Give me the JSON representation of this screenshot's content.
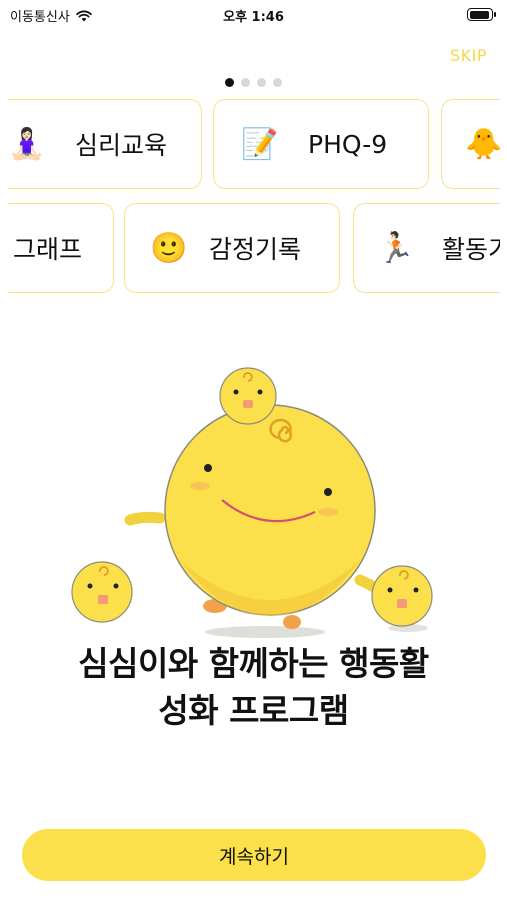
{
  "status_bar": {
    "carrier": "이동통신사",
    "time": "오후 1:46",
    "battery_level": 0.95
  },
  "skip_label": "SKIP",
  "pagination": {
    "total": 4,
    "active_index": 0
  },
  "features": {
    "row1": [
      {
        "icon": "🧘🏻‍♀️",
        "icon_name": "meditation-icon",
        "label": "심리교육"
      },
      {
        "icon": "📝",
        "icon_name": "memo-icon",
        "label": "PHQ-9"
      },
      {
        "icon": "🐥",
        "icon_name": "chick-icon",
        "label": ""
      }
    ],
    "row2": [
      {
        "icon": "",
        "icon_name": "",
        "label": "그래프"
      },
      {
        "icon": "🙂",
        "icon_name": "smile-icon",
        "label": "감정기록"
      },
      {
        "icon": "🏃🏻",
        "icon_name": "runner-icon",
        "label": "활동기"
      }
    ]
  },
  "title": {
    "line1": "심심이와 함께하는 행동활",
    "line2": "성화 프로그램"
  },
  "continue_label": "계속하기",
  "colors": {
    "accent": "#FBE04B",
    "card_border": "#F6E48A",
    "skip": "#F5D94A",
    "mascot": "#F9E04F"
  }
}
